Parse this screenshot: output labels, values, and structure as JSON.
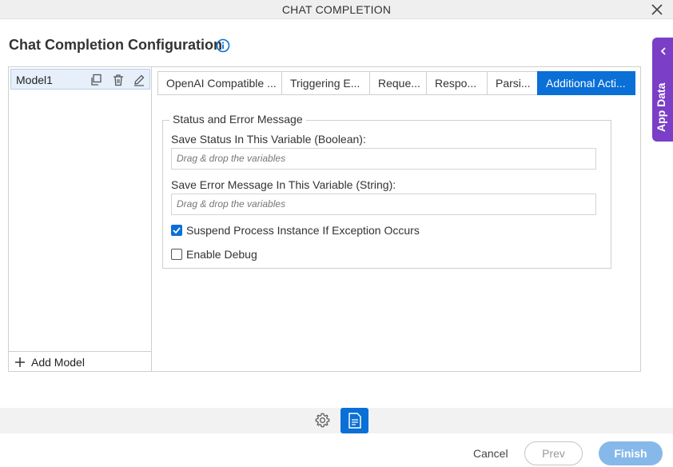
{
  "window": {
    "title": "CHAT COMPLETION"
  },
  "page": {
    "heading": "Chat Completion Configuration"
  },
  "side_panel": {
    "label": "App Data"
  },
  "models": {
    "items": [
      {
        "name": "Model1"
      }
    ],
    "add_label": "Add Model"
  },
  "tabs": [
    {
      "label": "OpenAI Compatible ..."
    },
    {
      "label": "Triggering E..."
    },
    {
      "label": "Reque..."
    },
    {
      "label": "Respo..."
    },
    {
      "label": "Parsi..."
    },
    {
      "label": "Additional Acti..."
    }
  ],
  "active_tab": 5,
  "section": {
    "legend": "Status and Error Message",
    "status_label": "Save Status In This Variable (Boolean):",
    "status_placeholder": "Drag & drop the variables",
    "error_label": "Save Error Message In This Variable (String):",
    "error_placeholder": "Drag & drop the variables",
    "suspend_label": "Suspend Process Instance If Exception Occurs",
    "suspend_checked": true,
    "debug_label": "Enable Debug",
    "debug_checked": false
  },
  "footer": {
    "cancel_label": "Cancel",
    "prev_label": "Prev",
    "finish_label": "Finish"
  },
  "colors": {
    "accent": "#0a6fd6",
    "app_data_panel": "#7a3ec7",
    "finish_disabled": "#86b9ea"
  },
  "icons": [
    "close-icon",
    "info-icon",
    "chevron-left-icon",
    "copy-icon",
    "trash-icon",
    "edit-icon",
    "plus-icon",
    "gear-icon",
    "document-icon"
  ]
}
